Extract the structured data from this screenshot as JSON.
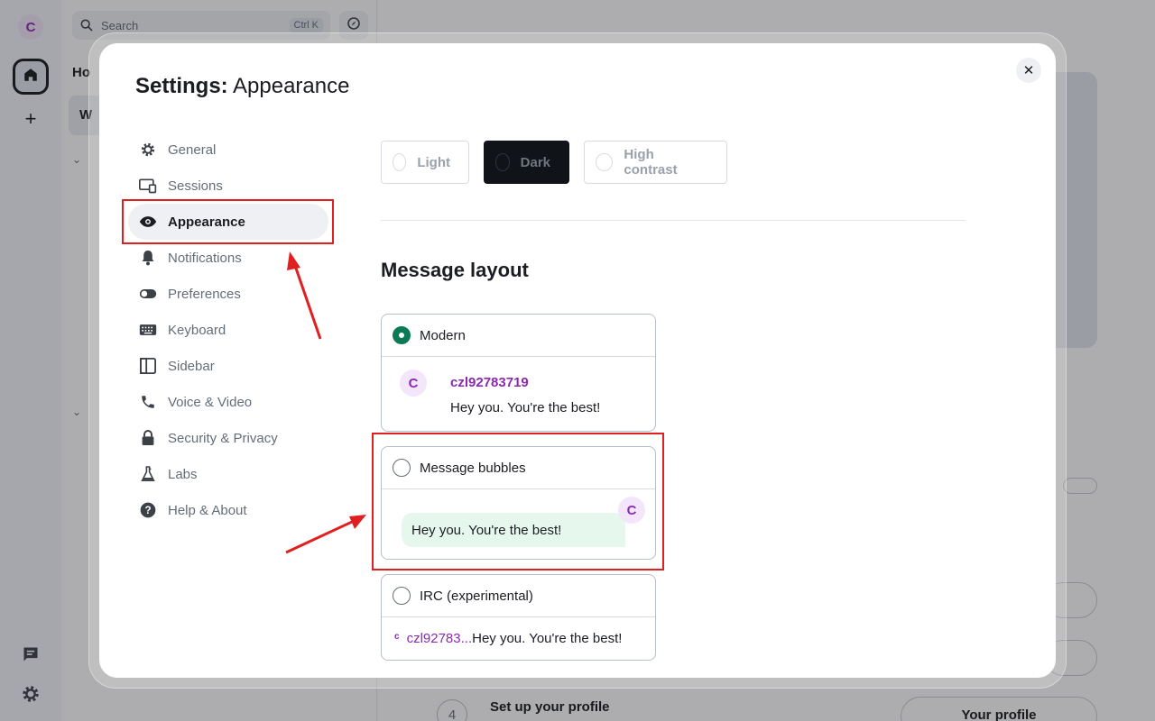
{
  "app": {
    "space_initial": "C",
    "search_placeholder": "Search",
    "search_shortcut": "Ctrl K",
    "home_heading": "Ho",
    "room_item": "W",
    "section_marker": "⌄",
    "step": {
      "number": "4",
      "title": "Set up your profile",
      "button": "Your profile"
    }
  },
  "dialog": {
    "title_prefix": "Settings:",
    "title_page": "Appearance",
    "close_icon": "close-icon",
    "tabs": [
      {
        "label": "General",
        "icon": "gear-icon"
      },
      {
        "label": "Sessions",
        "icon": "devices-icon"
      },
      {
        "label": "Appearance",
        "icon": "eye-icon",
        "active": true
      },
      {
        "label": "Notifications",
        "icon": "bell-icon"
      },
      {
        "label": "Preferences",
        "icon": "toggle-icon"
      },
      {
        "label": "Keyboard",
        "icon": "keyboard-icon"
      },
      {
        "label": "Sidebar",
        "icon": "sidebar-icon"
      },
      {
        "label": "Voice & Video",
        "icon": "phone-icon"
      },
      {
        "label": "Security & Privacy",
        "icon": "lock-icon"
      },
      {
        "label": "Labs",
        "icon": "flask-icon"
      },
      {
        "label": "Help & About",
        "icon": "help-icon"
      }
    ],
    "themes": [
      {
        "label": "Light"
      },
      {
        "label": "Dark",
        "selected": true
      },
      {
        "label": "High contrast"
      }
    ],
    "message_layout": {
      "heading": "Message layout",
      "options": [
        {
          "label": "Modern",
          "selected": true
        },
        {
          "label": "Message bubbles",
          "selected": false
        },
        {
          "label": "IRC (experimental)",
          "selected": false
        }
      ],
      "preview": {
        "avatar_initial": "C",
        "username": "czl92783719",
        "username_truncated": "czl92783...",
        "message": "Hey you. You're the best!",
        "irc_avatar_initial": "c"
      }
    }
  },
  "colors": {
    "accent": "#0d7a56",
    "username": "#8b2ab1",
    "annotation": "#e02020",
    "bubble": "#e6f7ee"
  }
}
